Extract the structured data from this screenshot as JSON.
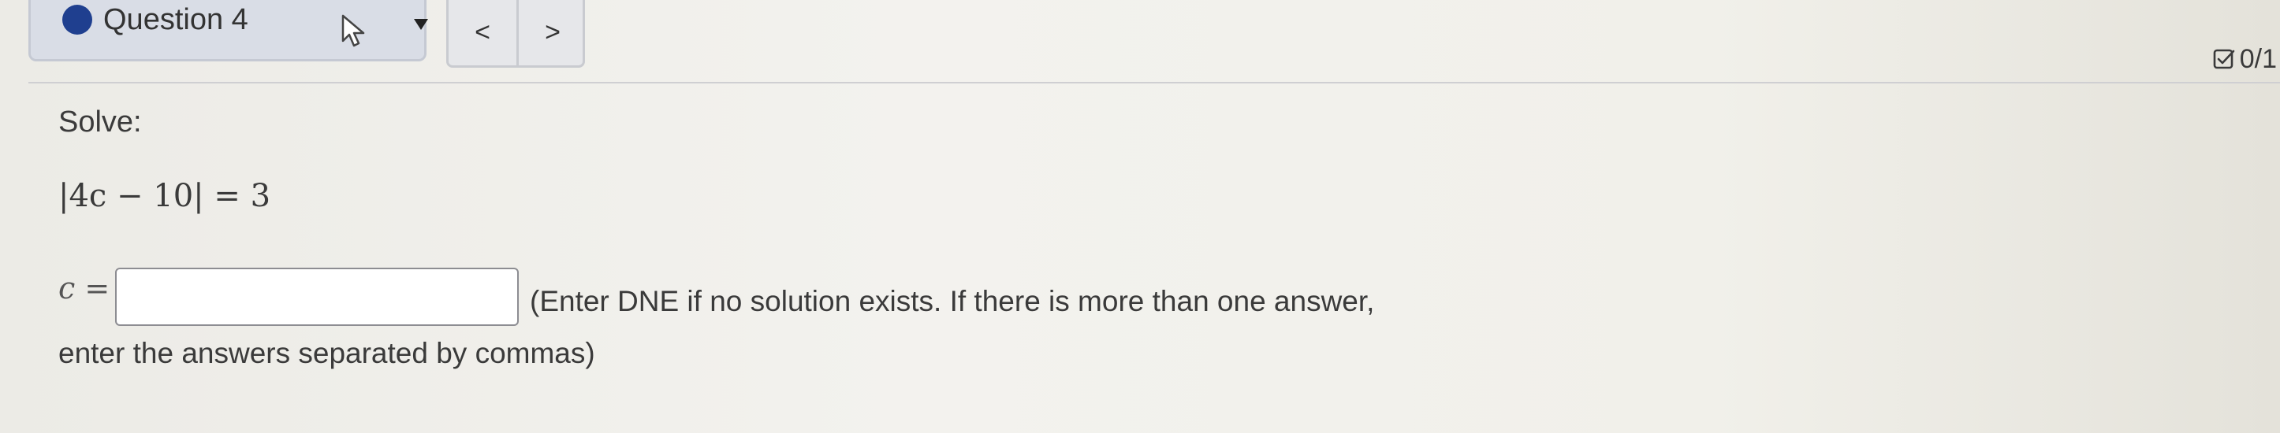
{
  "header": {
    "question_label": "Question 4",
    "status_icon": "filled-dot",
    "pointer_icon": "cursor-pointer",
    "dropdown_icon": "caret-down",
    "nav": {
      "prev_label": "<",
      "next_label": ">"
    },
    "score": "0/1",
    "score_icon": "checkbox-icon"
  },
  "question": {
    "instruction": "Solve:",
    "equation": "|4c − 10| = 3",
    "variable_label": "c =",
    "answer_value": "",
    "hint_line1": "(Enter DNE if no solution exists. If there is more than one answer,",
    "hint_line2": "enter the answers separated by commas)"
  },
  "colors": {
    "status_dot": "#1f3f8f",
    "tab_background": "#d9dde6",
    "page_background": "#f3f2ed"
  }
}
